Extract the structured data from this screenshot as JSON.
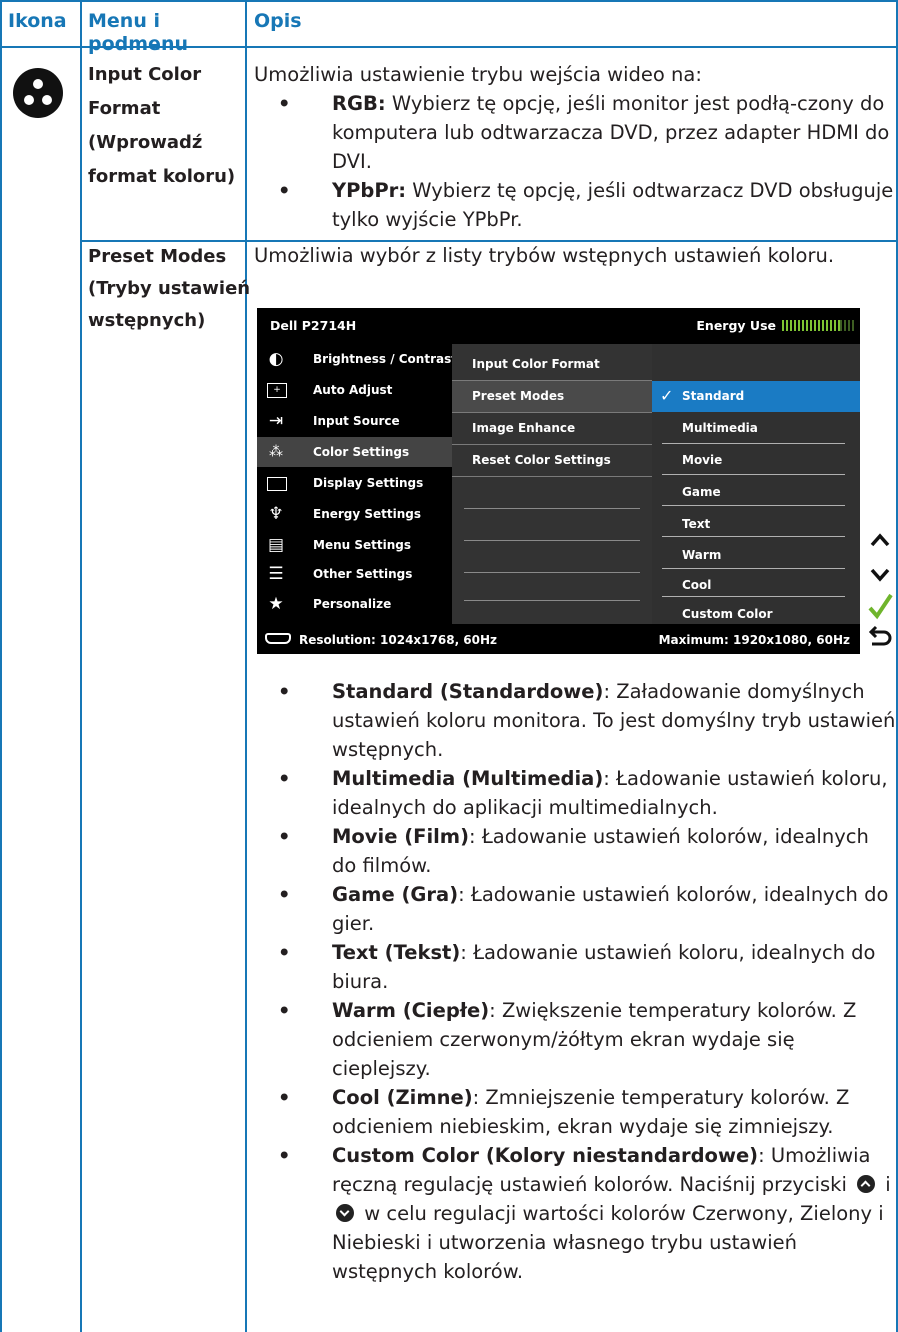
{
  "table": {
    "header": {
      "icon_col": "Ikona",
      "menu_col": "Menu i podmenu",
      "desc_col": "Opis"
    },
    "colors": {
      "accent": "#1777b6",
      "osd_selected": "#1a7bc4",
      "energy": "#7ec433"
    }
  },
  "input_color_format": {
    "icon": "color-settings-icon",
    "menu_lines": [
      "Input Color",
      "Format",
      "(Wprowadź",
      "format koloru)"
    ],
    "intro": "Umożliwia ustawienie trybu wejścia wideo na:",
    "options": [
      {
        "term": "RGB:",
        "text": " Wybierz tę opcję, jeśli monitor jest podłą-czony do komputera lub odtwarzacza DVD, przez adapter HDMI do DVI."
      },
      {
        "term": "YPbPr:",
        "text": " Wybierz tę opcję, jeśli odtwarzacz DVD obsługuje tylko wyjście YPbPr."
      }
    ]
  },
  "preset_modes": {
    "menu_lines": [
      "Preset Modes",
      "(Tryby ustawień",
      "wstępnych)"
    ],
    "intro": "Umożliwia wybór z listy trybów wstępnych ustawień koloru.",
    "osd": {
      "model": "Dell P2714H",
      "energy_label": "Energy Use",
      "main_menu": [
        {
          "label": "Brightness / Contrast",
          "icon": "brightness-icon"
        },
        {
          "label": "Auto Adjust",
          "icon": "auto-adjust-icon"
        },
        {
          "label": "Input Source",
          "icon": "input-source-icon"
        },
        {
          "label": "Color Settings",
          "icon": "color-settings-icon"
        },
        {
          "label": "Display Settings",
          "icon": "display-icon"
        },
        {
          "label": "Energy Settings",
          "icon": "energy-icon"
        },
        {
          "label": "Menu Settings",
          "icon": "menu-icon"
        },
        {
          "label": "Other Settings",
          "icon": "other-settings-icon"
        },
        {
          "label": "Personalize",
          "icon": "star-icon"
        }
      ],
      "sub_menu": [
        "Input Color Format",
        "Preset Modes",
        "Image Enhance",
        "Reset Color Settings"
      ],
      "modes": [
        "Standard",
        "Multimedia",
        "Movie",
        "Game",
        "Text",
        "Warm",
        "Cool",
        "Custom Color"
      ],
      "resolution": "Resolution: 1024x1768, 60Hz",
      "maximum": "Maximum: 1920x1080, 60Hz",
      "side_buttons": [
        "up-arrow-icon",
        "down-arrow-icon",
        "check-icon",
        "back-icon"
      ]
    },
    "bullets": [
      {
        "term": "Standard (Standardowe)",
        "text": ": Załadowanie domyślnych ustawień koloru monitora. To jest domyślny tryb ustawień wstępnych."
      },
      {
        "term": "Multimedia (Multimedia)",
        "text": ": Ładowanie ustawień koloru, idealnych do aplikacji multimedialnych."
      },
      {
        "term": "Movie (Film)",
        "text": ": Ładowanie ustawień kolorów, idealnych do filmów."
      },
      {
        "term": "Game (Gra)",
        "text": ": Ładowanie ustawień kolorów, idealnych do gier."
      },
      {
        "term": "Text (Tekst)",
        "text": ": Ładowanie ustawień koloru, idealnych do biura."
      },
      {
        "term": "Warm (Ciepłe)",
        "text": ": Zwiększenie temperatury kolorów. Z odcieniem czerwonym/żółtym ekran wydaje się cieplejszy."
      },
      {
        "term": "Cool (Zimne)",
        "text": ": Zmniejszenie temperatury kolorów. Z odcieniem niebieskim, ekran wydaje się zimniejszy."
      }
    ],
    "custom": {
      "term": "Custom Color (Kolory niestandardowe)",
      "text_a": ": Umożliwia ręczną regulację ustawień kolorów. Naciśnij przyciski ",
      "text_b": " i ",
      "text_c": " w celu regulacji wartości kolorów Czerwony, Zielony i Niebieski i utworzenia własnego trybu ustawień wstępnych kolorów."
    }
  }
}
